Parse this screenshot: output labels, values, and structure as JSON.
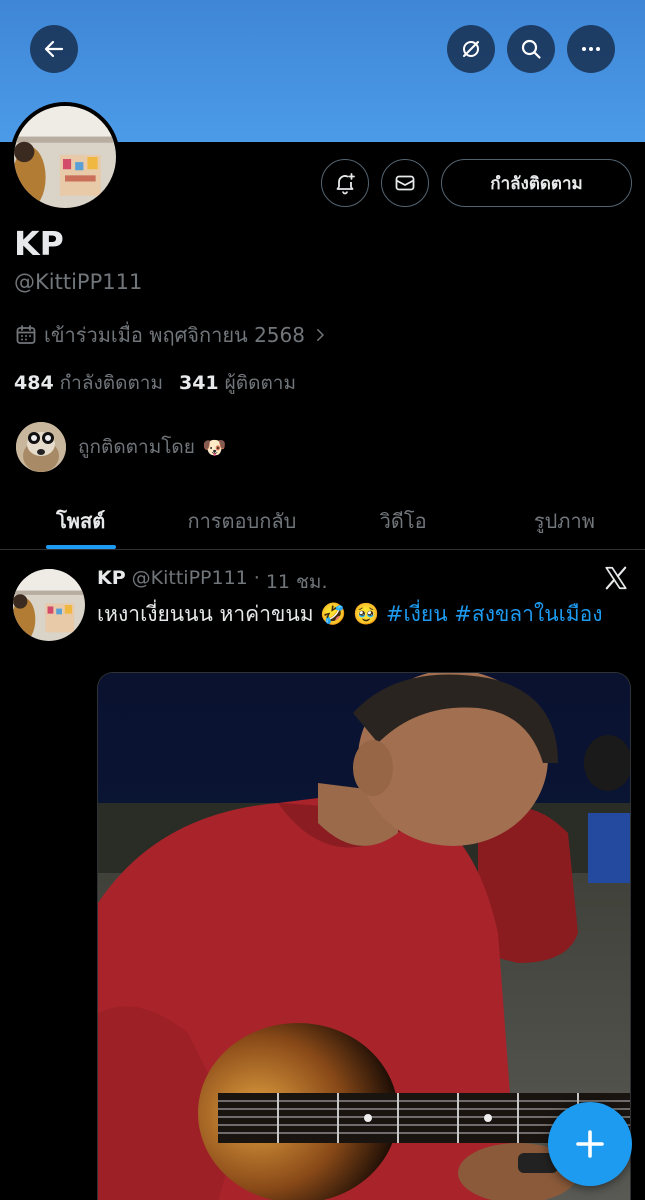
{
  "profile": {
    "name": "KP",
    "handle": "@KittiPP111",
    "joined": "เข้าร่วมเมื่อ พฤศจิกายน 2568",
    "following_count": "484",
    "following_label": "กำลังติดตาม",
    "followers_count": "341",
    "followers_label": "ผู้ติดตาม",
    "followed_by": "ถูกติดตามโดย",
    "followed_by_emoji": "🐶",
    "follow_button": "กำลังติดตาม"
  },
  "tabs": [
    {
      "label": "โพสต์",
      "active": true
    },
    {
      "label": "การตอบกลับ",
      "active": false
    },
    {
      "label": "วิดีโอ",
      "active": false
    },
    {
      "label": "รูปภาพ",
      "active": false
    }
  ],
  "post": {
    "author": "KP",
    "handle": "@KittiPP111",
    "separator": "·",
    "time": "11 ชม.",
    "text": "เหงาเงี่ยนนน หาค่าขนม 🤣 🥹",
    "tag1": "#เงี่ยน",
    "tag2": "#สงขลาในเมือง"
  },
  "colors": {
    "banner": "#4b9be8",
    "accent": "#1d9bf0",
    "muted": "#71767b",
    "text": "#e7e9ea",
    "background": "#000000"
  },
  "icons": {
    "back": "back-arrow-icon",
    "grok": "grok-icon",
    "search": "search-icon",
    "more": "more-icon",
    "notify": "bell-plus-icon",
    "message": "envelope-icon",
    "calendar": "calendar-icon",
    "x": "x-logo-icon",
    "compose": "plus-icon"
  }
}
